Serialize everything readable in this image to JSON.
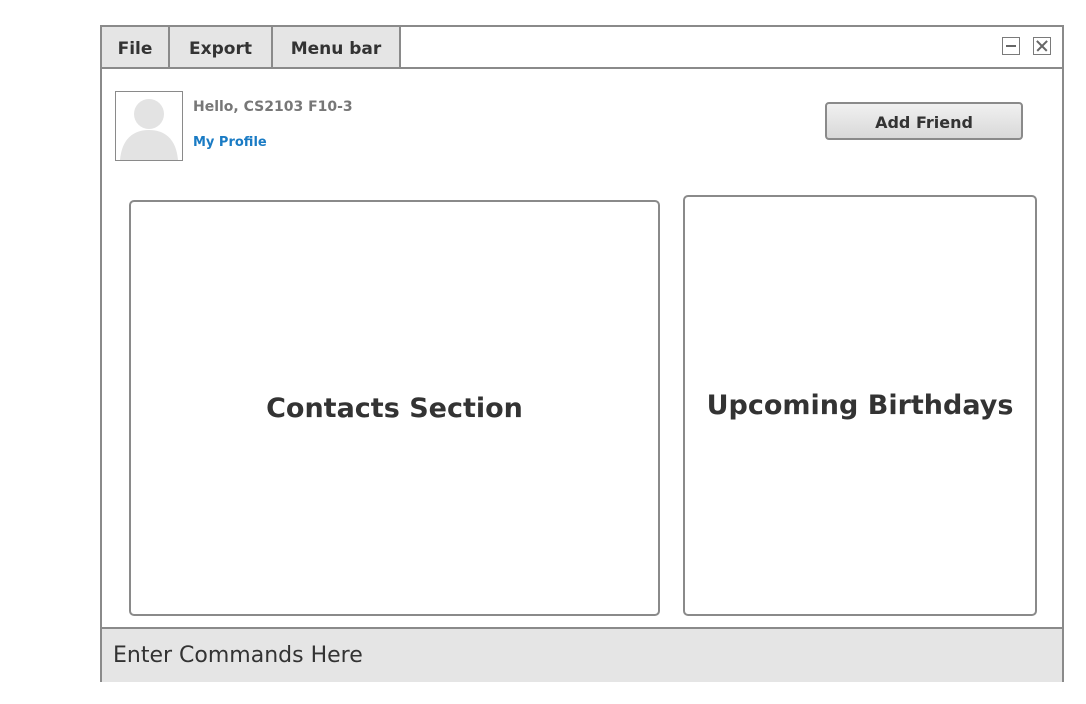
{
  "menubar": {
    "items": [
      {
        "label": "File"
      },
      {
        "label": "Export"
      },
      {
        "label": "Menu bar"
      }
    ]
  },
  "window_controls": {
    "minimize_icon": "minimize-icon",
    "close_icon": "close-icon"
  },
  "header": {
    "avatar_icon": "user-avatar-icon",
    "greeting": "Hello, CS2103 F10-3",
    "profile_link": "My Profile",
    "add_friend_label": "Add Friend"
  },
  "main": {
    "contacts_title": "Contacts Section",
    "birthdays_title": "Upcoming Birthdays"
  },
  "command": {
    "placeholder": "Enter Commands Here"
  },
  "colors": {
    "link": "#1a7bc4",
    "chrome_gray": "#e5e5e5",
    "border": "#8a8a8a"
  }
}
